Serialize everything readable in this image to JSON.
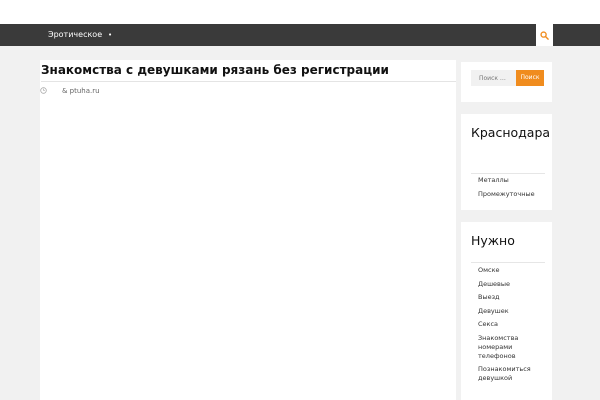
{
  "nav": {
    "menu_item": "Эротическое",
    "dropdown_marker": "•",
    "search_icon": "search-icon"
  },
  "post": {
    "title": "Знакомства с девушками рязань без регистрации",
    "date_icon": "clock-icon",
    "author": "& ptuha.ru"
  },
  "sidebar": {
    "search": {
      "placeholder": "Поиск …",
      "button": "Поиск"
    },
    "widgets": [
      {
        "title": "Краснодара",
        "items": [
          "Металлы",
          "Промежуточные"
        ]
      },
      {
        "title": "Нужно",
        "items": [
          "Омске",
          "Дешевые",
          "Выезд",
          "Девушек",
          "Секса",
          "Знакомства номерами телефонов",
          "Познакомиться девушкой"
        ]
      }
    ]
  },
  "colors": {
    "navbar": "#3a3a3a",
    "accent": "#f08c1e",
    "background": "#f1f1f1"
  }
}
